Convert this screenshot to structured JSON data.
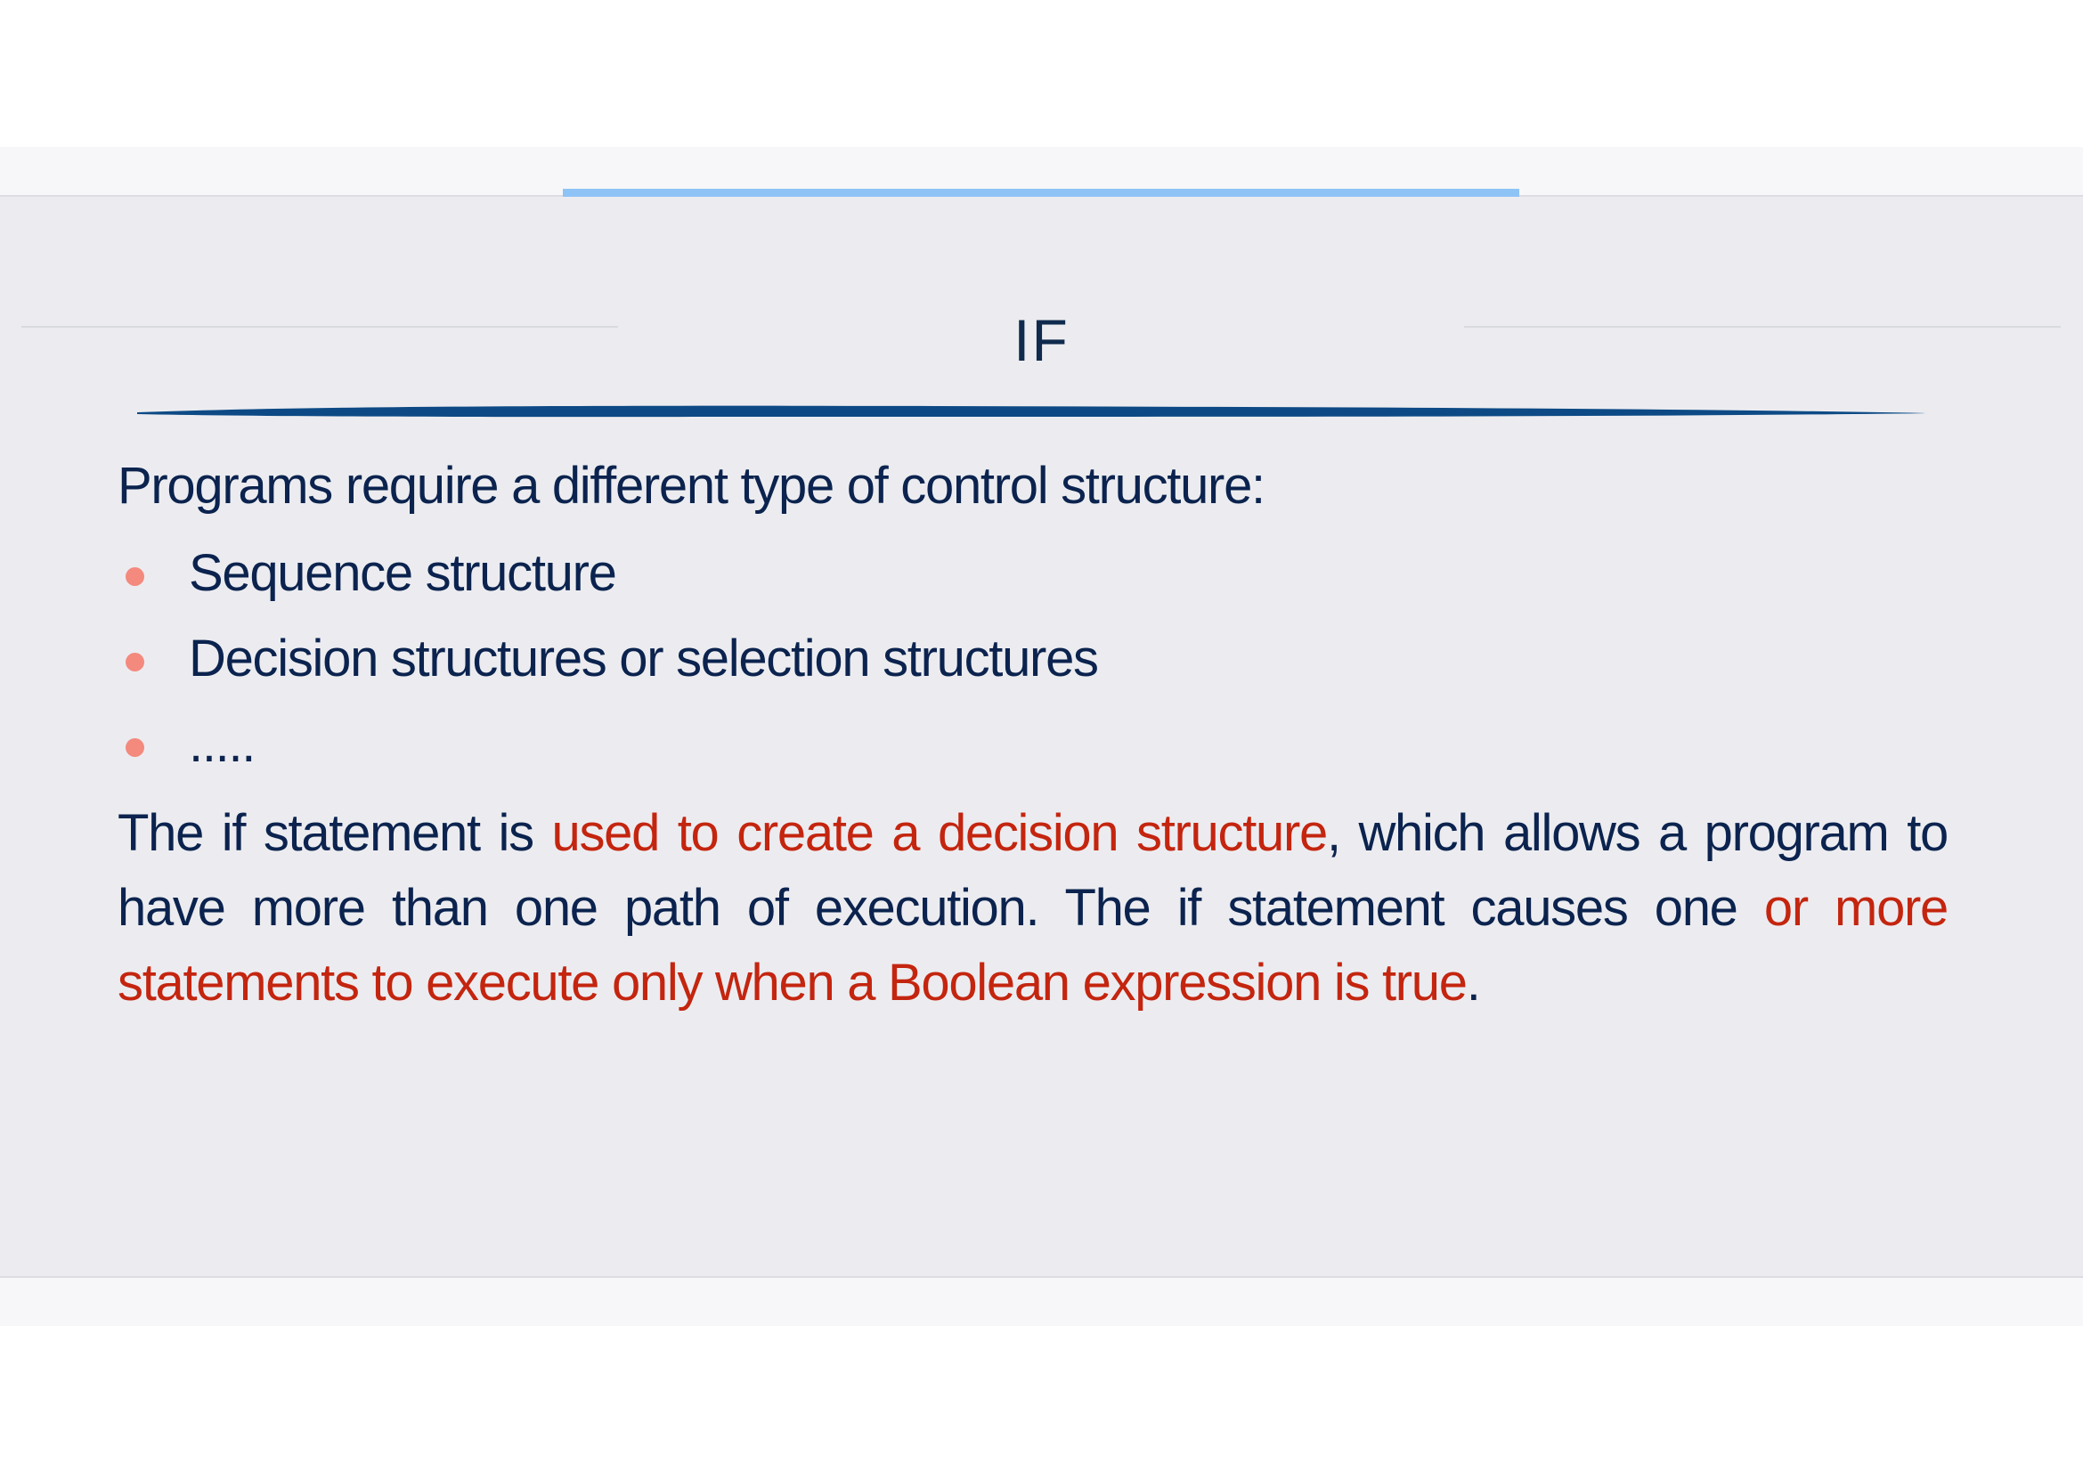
{
  "slide": {
    "title": "IF",
    "intro": "Programs require a different type of control structure:",
    "bullets": [
      "Sequence structure",
      "Decision structures or selection structures",
      "....."
    ],
    "paragraph": {
      "part1": "The if statement is ",
      "highlight1": "used to create a decision structure",
      "part2": ", which allows a program to have more than one path of execution. The if statement causes one ",
      "highlight2": "or more statements to execute only when a Boolean expression is true",
      "part3": "."
    }
  },
  "colors": {
    "text": "#0b234e",
    "highlight": "#c4250f",
    "bullet": "#f4897e",
    "title_underline": "#0d4a85",
    "accent_bar": "#8ec3f5",
    "slide_background": "#ececf0"
  }
}
